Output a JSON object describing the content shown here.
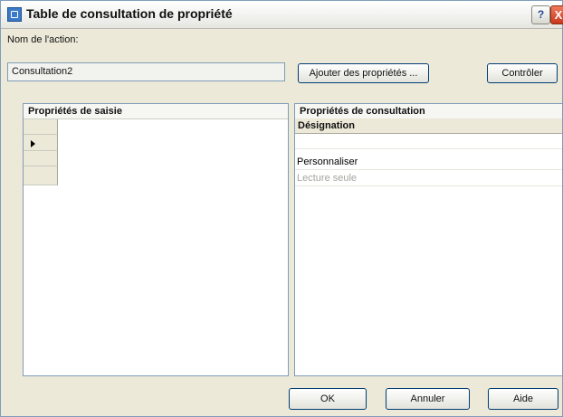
{
  "window": {
    "title": "Table de consultation de propriété",
    "help_label": "?",
    "close_label": "X"
  },
  "action": {
    "name_label": "Nom de l'action:",
    "name_value": "Consultation2"
  },
  "buttons": {
    "add_properties": "Ajouter des propriétés ...",
    "check": "Contrôler",
    "ok": "OK",
    "cancel": "Annuler",
    "help": "Aide"
  },
  "input_panel": {
    "header": "Propriétés de saisie"
  },
  "lookup_panel": {
    "header": "Propriétés de consultation",
    "column_header": "Désignation",
    "rows": [
      {
        "label": ""
      },
      {
        "label": "Personnaliser"
      },
      {
        "label": "Lecture seule"
      }
    ]
  }
}
